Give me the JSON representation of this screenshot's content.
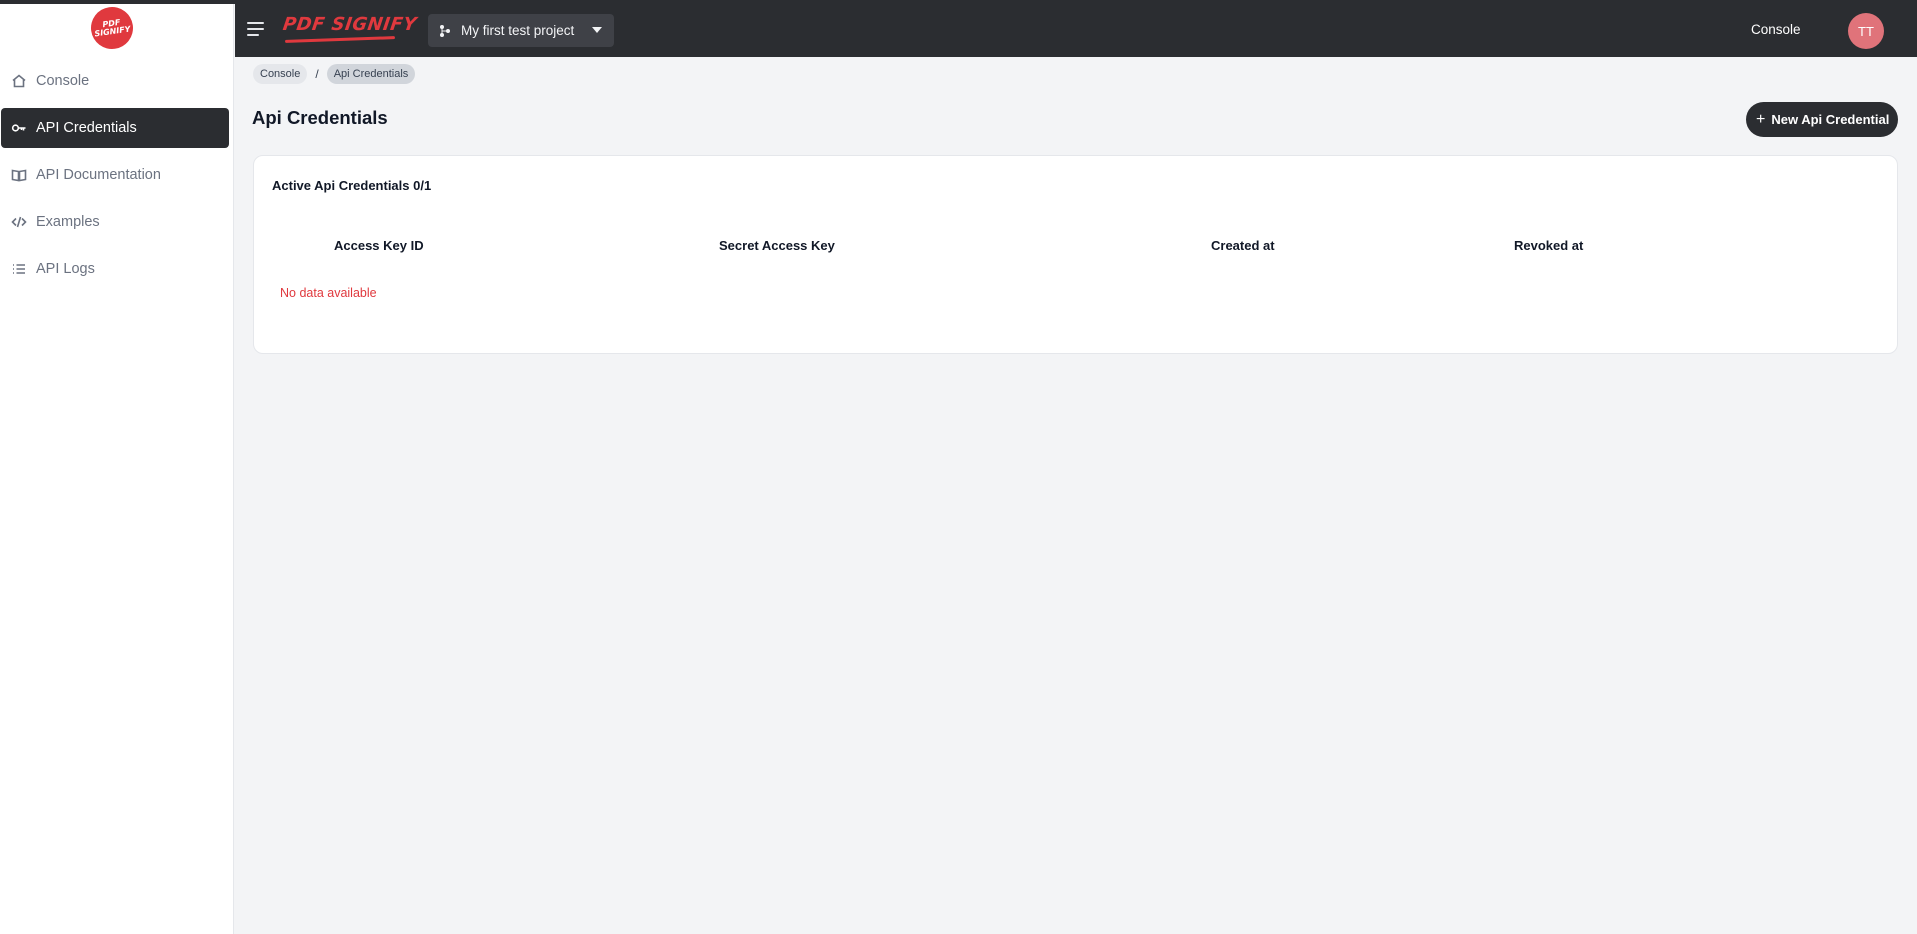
{
  "sidebar": {
    "logo_text": "PDF SIGNIFY",
    "items": [
      {
        "label": "Console",
        "icon": "home-icon"
      },
      {
        "label": "API Credentials",
        "icon": "key-icon"
      },
      {
        "label": "API Documentation",
        "icon": "book-icon"
      },
      {
        "label": "Examples",
        "icon": "code-icon"
      },
      {
        "label": "API Logs",
        "icon": "list-icon"
      }
    ]
  },
  "header": {
    "brand": "PDF SIGNIFY",
    "project": "My first test project",
    "console_link": "Console",
    "avatar_initials": "TT"
  },
  "breadcrumb": [
    "Console",
    "Api Credentials"
  ],
  "page": {
    "title": "Api Credentials",
    "new_button": "New Api Credential"
  },
  "card": {
    "title": "Active Api Credentials 0/1",
    "columns": [
      "Access Key ID",
      "Secret Access Key",
      "Created at",
      "Revoked at"
    ],
    "empty_text": "No data available"
  },
  "colors": {
    "accent": "#e0393e",
    "dark": "#2b2d31",
    "avatar": "#e0737a"
  }
}
